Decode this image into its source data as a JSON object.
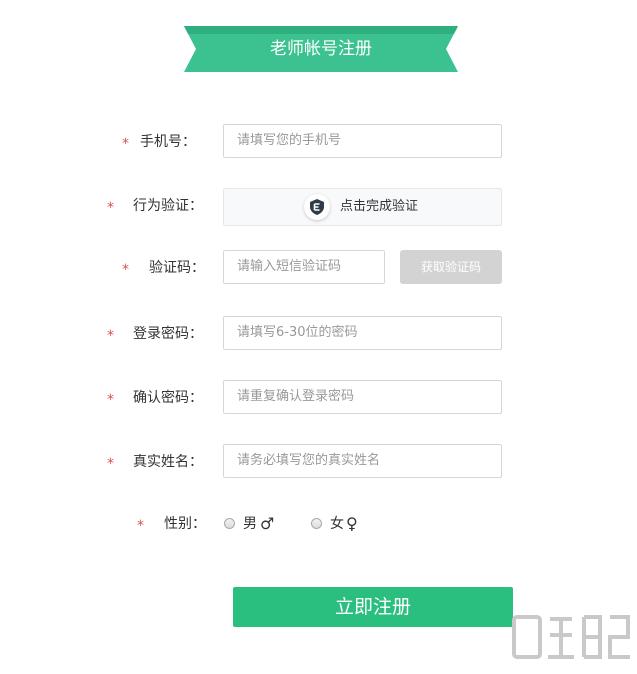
{
  "header": {
    "title": "老师帐号注册"
  },
  "form": {
    "phone": {
      "label": "手机号：",
      "placeholder": "请填写您的手机号"
    },
    "behavior_verify": {
      "label": "行为验证：",
      "button_text": "点击完成验证"
    },
    "sms_code": {
      "label": "验证码：",
      "placeholder": "请输入短信验证码",
      "get_code_label": "获取验证码"
    },
    "password": {
      "label": "登录密码：",
      "placeholder": "请填写6-30位的密码"
    },
    "confirm_password": {
      "label": "确认密码：",
      "placeholder": "请重复确认登录密码"
    },
    "real_name": {
      "label": "真实姓名：",
      "placeholder": "请务必填写您的真实姓名"
    },
    "gender": {
      "label": "性别：",
      "male": "男",
      "male_symbol": "♂",
      "female": "女",
      "female_symbol": "♀"
    },
    "required_mark": "*"
  },
  "submit": {
    "label": "立即注册"
  },
  "colors": {
    "accent": "#2bbf7f",
    "ribbon": "#3cc191",
    "required": "#d9534f",
    "disabled_button": "#d3d3d3"
  }
}
